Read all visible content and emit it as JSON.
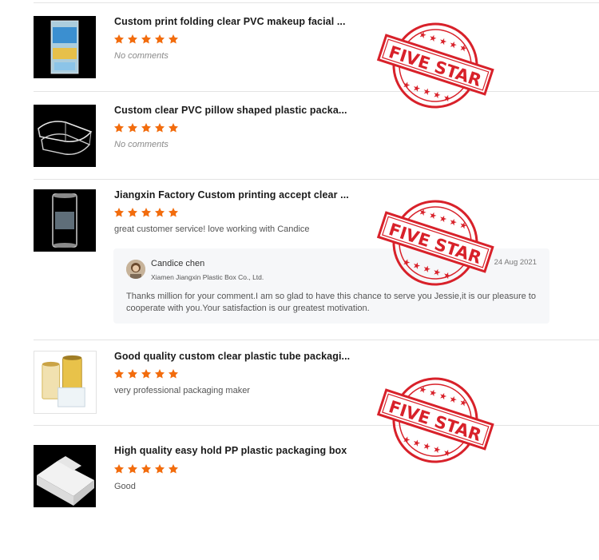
{
  "reviews": [
    {
      "title": "Custom print folding clear PVC makeup facial ...",
      "rating": 5,
      "comment": "No comments",
      "thumb_icon": "pvc-box-product-image"
    },
    {
      "title": "Custom clear PVC pillow shaped plastic packa...",
      "rating": 5,
      "comment": "No comments",
      "thumb_icon": "pillow-box-product-image"
    },
    {
      "title": "Jiangxin Factory Custom printing accept clear ...",
      "rating": 5,
      "comment": "great customer service! love working with Candice",
      "thumb_icon": "clear-tube-product-image",
      "reply": {
        "name": "Candice chen",
        "company": "Xiamen Jiangxin Plastic Box Co., Ltd.",
        "date": "24 Aug 2021",
        "text": "Thanks million for your comment.I am so glad  to have this chance to serve you Jessie,it is our pleasure to cooperate with you.Your satisfaction is our greatest motivation."
      }
    },
    {
      "title": "Good quality custom clear plastic tube packagi...",
      "rating": 5,
      "comment": "very professional packaging maker",
      "thumb_icon": "tube-packaging-product-image"
    },
    {
      "title": "High quality easy hold PP plastic packaging box",
      "rating": 5,
      "comment": "Good",
      "thumb_icon": "pp-box-product-image"
    }
  ],
  "stamp": {
    "text": "FIVE STAR",
    "color": "#d8212a"
  },
  "colors": {
    "star": "#f26c0d",
    "divider": "#e3e3e3"
  }
}
